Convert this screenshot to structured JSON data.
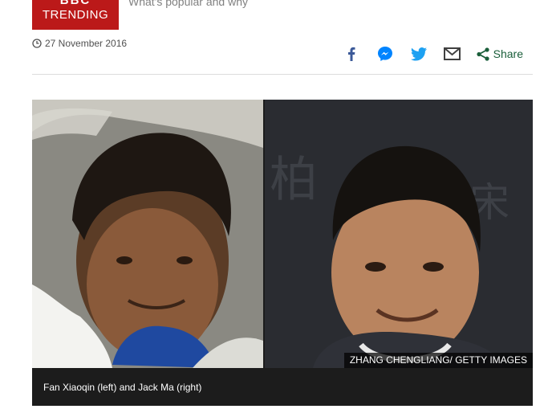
{
  "brand": {
    "logo": "BBC",
    "section": "TRENDING",
    "tagline": "What's popular and why"
  },
  "article": {
    "date": "27 November 2016"
  },
  "share": {
    "label": "Share",
    "icons": [
      "facebook-icon",
      "messenger-icon",
      "twitter-icon",
      "email-icon",
      "share-icon"
    ],
    "colors": {
      "facebook": "#3b5998",
      "messenger": "#0084ff",
      "twitter": "#1da1f2",
      "email": "#404040",
      "share": "#1a5e3a"
    }
  },
  "figure": {
    "credit": "ZHANG CHENGLIANG/ GETTY IMAGES",
    "caption": "Fan Xiaoqin (left) and Jack Ma (right)"
  },
  "colors": {
    "brand_red": "#bb1919"
  }
}
